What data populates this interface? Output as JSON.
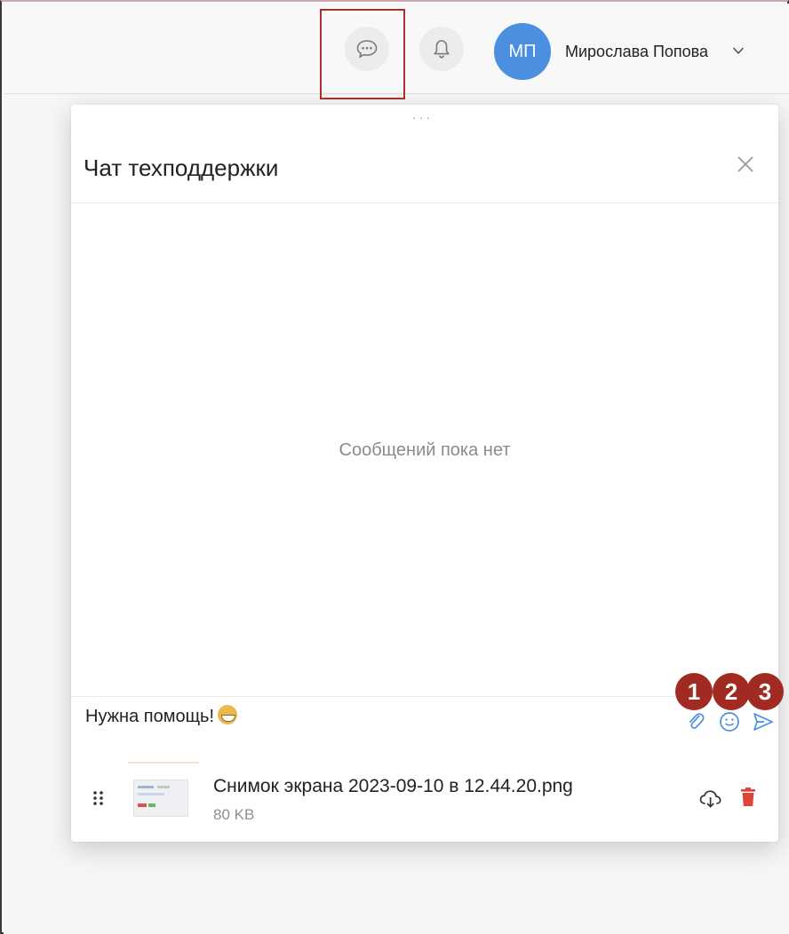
{
  "header": {
    "avatar_initials": "МП",
    "user_name": "Мирослава Попова"
  },
  "panel": {
    "title": "Чат техподдержки",
    "drag_handle": "···",
    "empty_text": "Сообщений пока нет",
    "message_text": "Нужна помощь!",
    "emoji_name": "grinning-face-emoji"
  },
  "annotations": [
    "1",
    "2",
    "3"
  ],
  "attachment": {
    "file_name": "Снимок экрана 2023-09-10 в 12.44.20.png",
    "file_size": "80 KB"
  },
  "colors": {
    "accent": "#4a8fe0",
    "annotation": "#a12b22",
    "delete": "#d9443b",
    "tool_icon": "#4a8fe0"
  }
}
